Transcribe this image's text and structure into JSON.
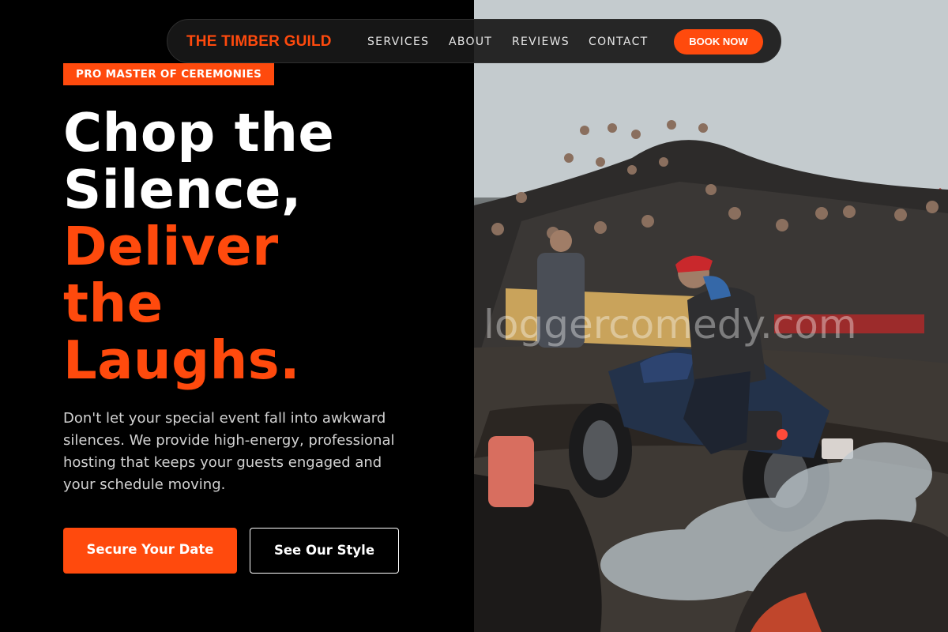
{
  "header": {
    "brand": "THE TIMBER GUILD",
    "nav": [
      {
        "label": "SERVICES"
      },
      {
        "label": "ABOUT"
      },
      {
        "label": "REVIEWS"
      },
      {
        "label": "CONTACT"
      }
    ],
    "cta_label": "BOOK NOW"
  },
  "hero": {
    "badge": "PRO MASTER OF CEREMONIES",
    "headline_lines": [
      "Chop the",
      "Silence,"
    ],
    "headline_accent_lines": [
      "Deliver",
      "the",
      "Laughs."
    ],
    "description": "Don't let your special event fall into awkward silences. We provide high-energy, professional hosting that keeps your guests engaged and your schedule moving.",
    "primary_button": "Secure Your Date",
    "secondary_button": "See Our Style"
  },
  "photo": {
    "watermark": "loggercomedy.com",
    "subject": "motorcycle-burnout-crowd-photo"
  },
  "colors": {
    "accent": "#ff4a0d",
    "background": "#000000",
    "nav_background": "#181818",
    "text_primary": "#ffffff",
    "text_secondary": "#d2d2d2"
  }
}
